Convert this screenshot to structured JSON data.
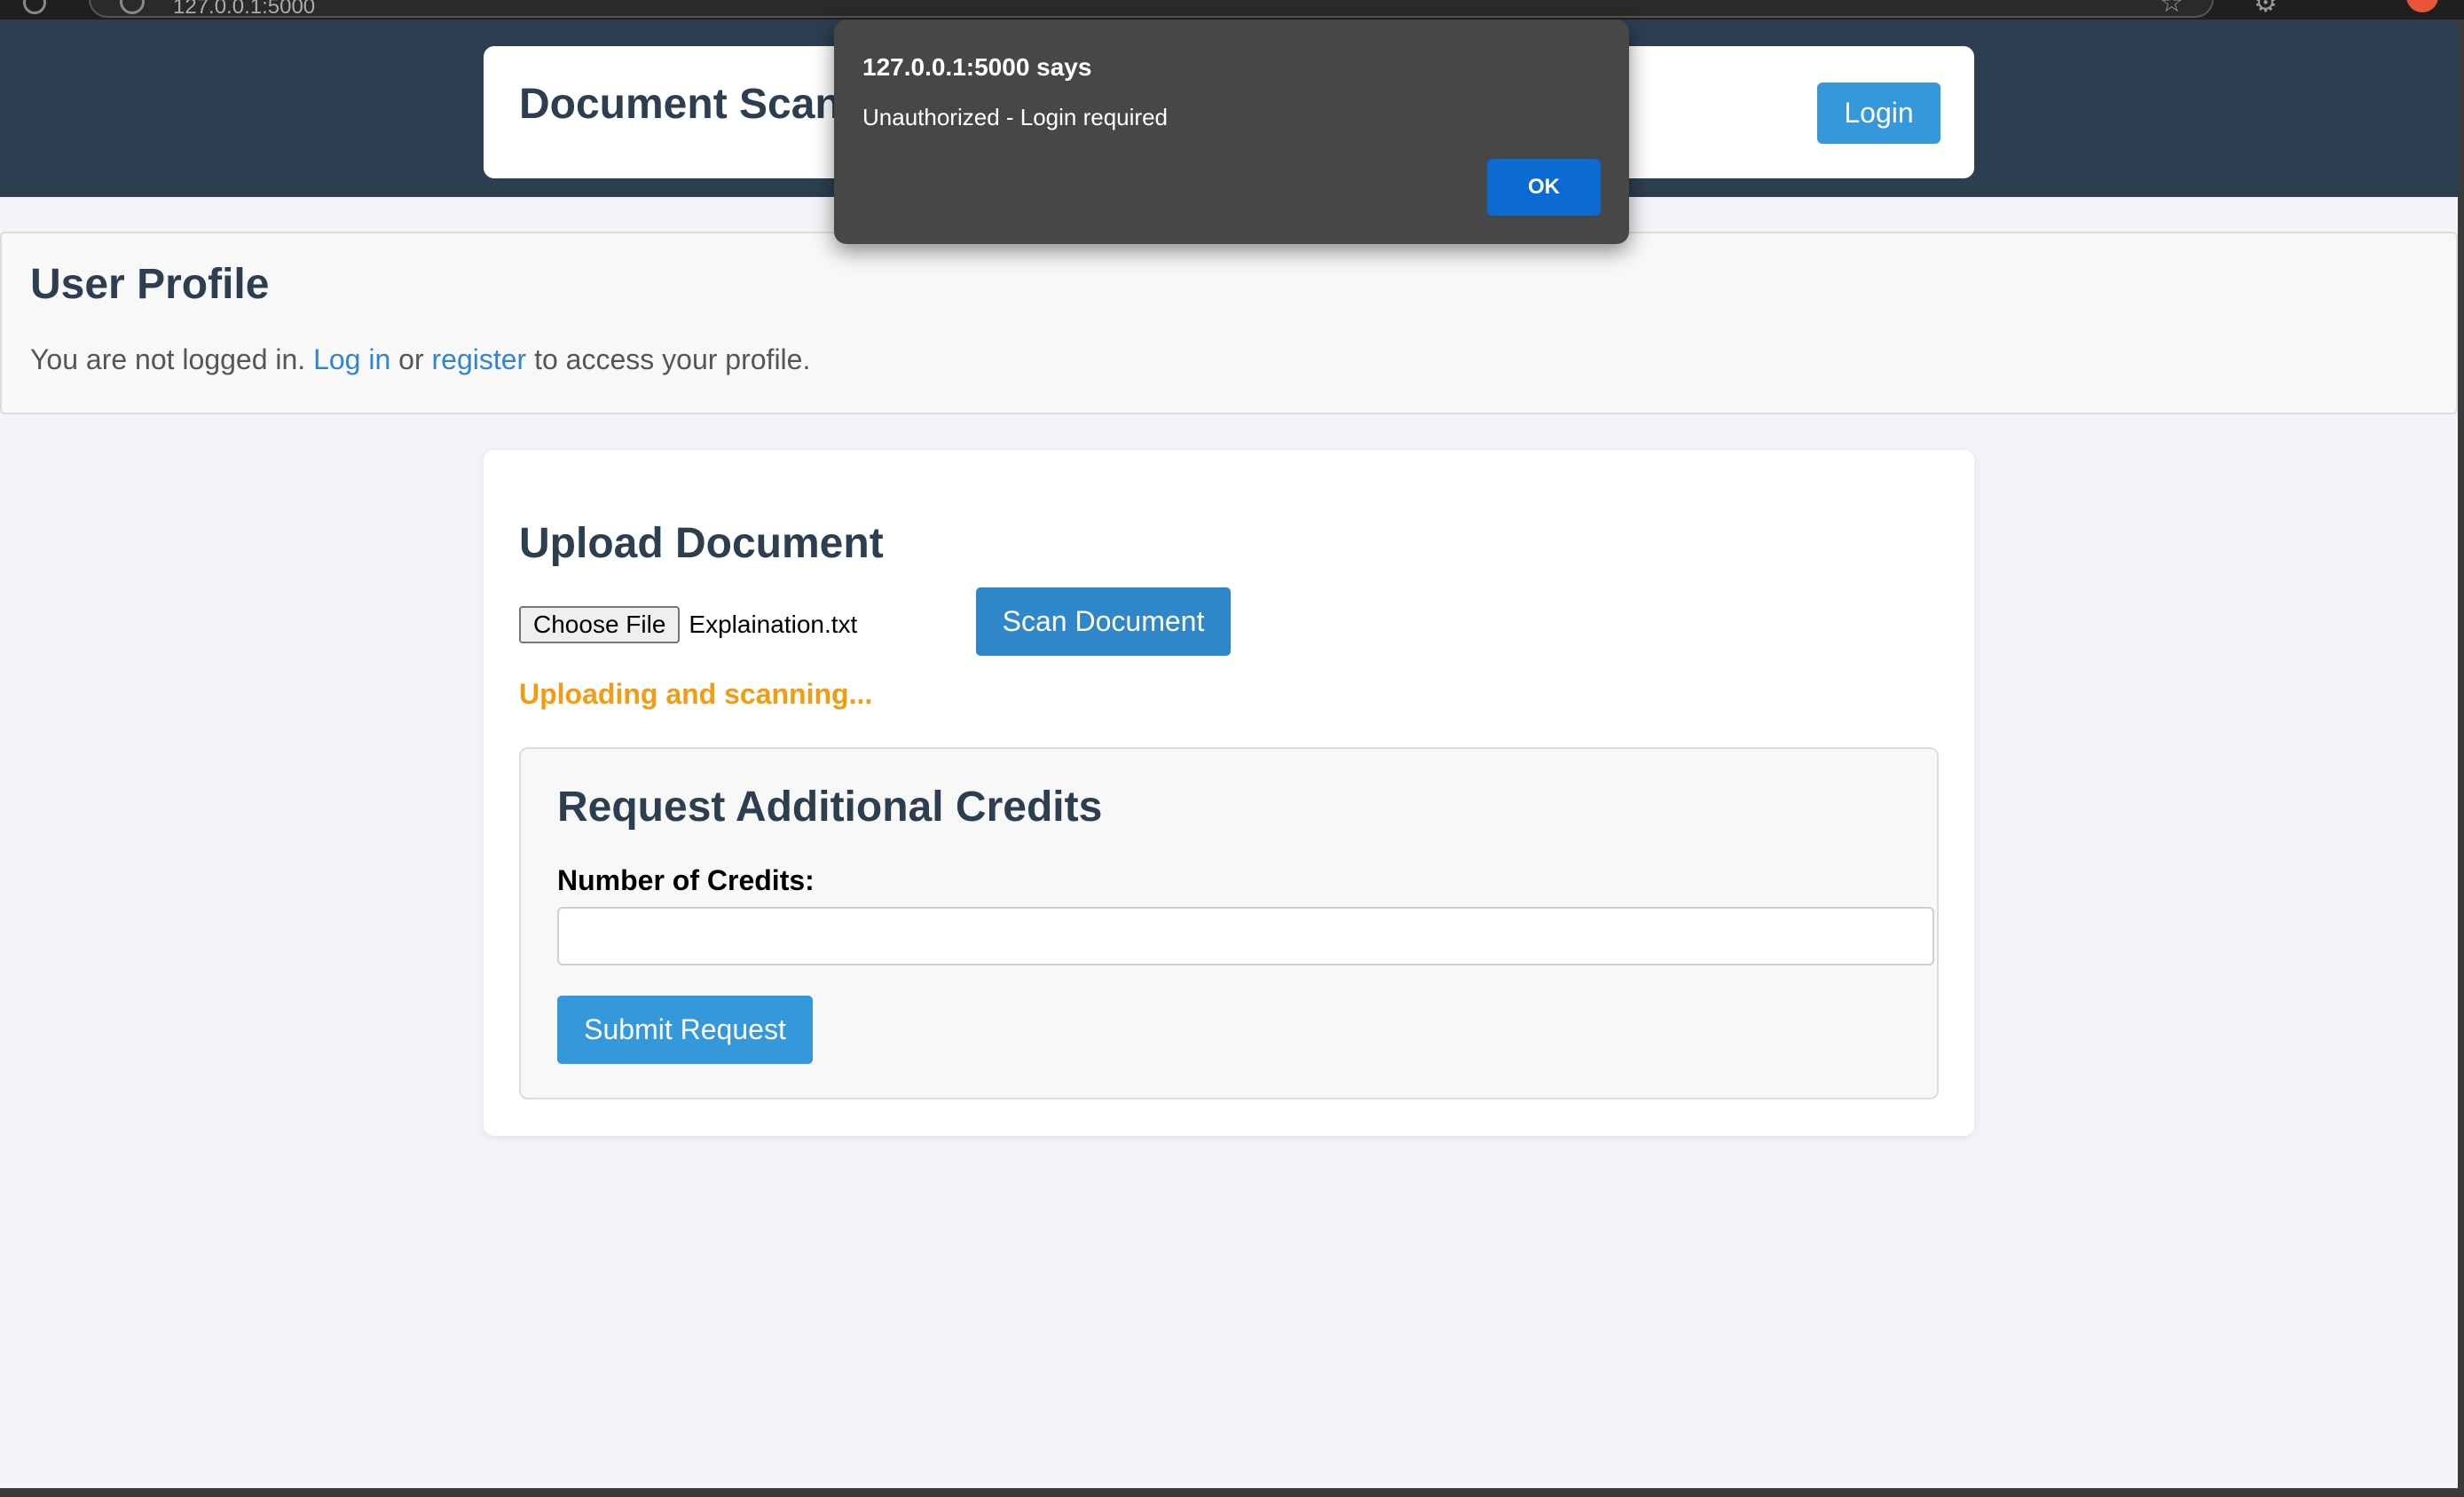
{
  "browser": {
    "url": "127.0.0.1:5000",
    "icons": [
      "reload-icon",
      "site-info-icon",
      "bookmark-star-icon",
      "extensions-icon",
      "profile-avatar"
    ]
  },
  "header": {
    "title": "Document Scanner",
    "login_label": "Login"
  },
  "profile": {
    "title": "User Profile",
    "text_before": "You are not logged in. ",
    "login_link": "Log in",
    "text_middle": " or ",
    "register_link": "register",
    "text_after": " to access your profile."
  },
  "upload": {
    "title": "Upload Document",
    "choose_file_label": "Choose File",
    "file_name": "Explaination.txt",
    "scan_label": "Scan Document",
    "status": "Uploading and scanning..."
  },
  "credits": {
    "title": "Request Additional Credits",
    "label": "Number of Credits:",
    "value": "",
    "submit_label": "Submit Request"
  },
  "dialog": {
    "title": "127.0.0.1:5000 says",
    "message": "Unauthorized - Login required",
    "ok_label": "OK"
  },
  "colors": {
    "header_bg": "#2c3e50",
    "accent": "#3498db",
    "status": "#f39c12",
    "link": "#2f86d0",
    "dialog_bg": "#474747",
    "dialog_ok": "#0b6bd3"
  }
}
